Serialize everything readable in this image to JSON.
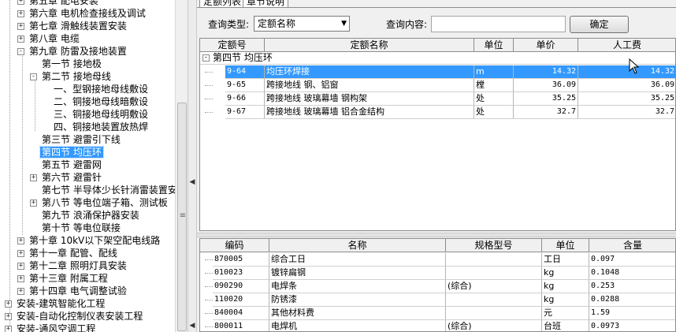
{
  "tree": {
    "items": [
      {
        "label": "第五章 配电安装",
        "level": 1,
        "exp": "+"
      },
      {
        "label": "第六章 电机检查接线及调试",
        "level": 1,
        "exp": "+"
      },
      {
        "label": "第七章 滑触线装置安装",
        "level": 1,
        "exp": "+"
      },
      {
        "label": "第八章 电缆",
        "level": 1,
        "exp": "+"
      },
      {
        "label": "第九章 防雷及接地装置",
        "level": 1,
        "exp": "-"
      },
      {
        "label": "第一节 接地极",
        "level": 2,
        "exp": ""
      },
      {
        "label": "第二节 接地母线",
        "level": 2,
        "exp": "-"
      },
      {
        "label": "一、型钢接地母线敷设",
        "level": 3,
        "exp": ""
      },
      {
        "label": "二、铜接地母线暗敷设",
        "level": 3,
        "exp": ""
      },
      {
        "label": "三、铜接地母线明敷设",
        "level": 3,
        "exp": ""
      },
      {
        "label": "四、铜接地装置放热焊",
        "level": 3,
        "exp": ""
      },
      {
        "label": "第三节 避雷引下线",
        "level": 2,
        "exp": ""
      },
      {
        "label": "第四节 均压环",
        "level": 2,
        "exp": "",
        "selected": true
      },
      {
        "label": "第五节 避雷网",
        "level": 2,
        "exp": ""
      },
      {
        "label": "第六节 避雷针",
        "level": 2,
        "exp": "+"
      },
      {
        "label": "第七节 半导体少长针消雷装置安",
        "level": 2,
        "exp": ""
      },
      {
        "label": "第八节 等电位端子箱、测试板",
        "level": 2,
        "exp": "+"
      },
      {
        "label": "第九节 浪涌保护器安装",
        "level": 2,
        "exp": ""
      },
      {
        "label": "第十节 等电位联接",
        "level": 2,
        "exp": ""
      },
      {
        "label": "第十章 10kV以下架空配电线路",
        "level": 1,
        "exp": "+"
      },
      {
        "label": "第十一章 配管、配线",
        "level": 1,
        "exp": "+"
      },
      {
        "label": "第十二章 照明灯具安装",
        "level": 1,
        "exp": "+"
      },
      {
        "label": "第十三章 附属工程",
        "level": 1,
        "exp": "+"
      },
      {
        "label": "第十四章 电气调整试验",
        "level": 1,
        "exp": "+"
      },
      {
        "label": "安装-建筑智能化工程",
        "level": 0,
        "exp": "+"
      },
      {
        "label": "安装-自动化控制仪表安装工程",
        "level": 0,
        "exp": "+"
      },
      {
        "label": "安装-通风空调工程",
        "level": 0,
        "exp": "+"
      }
    ]
  },
  "tabs": [
    "定额列表",
    "章节说明"
  ],
  "query": {
    "type_label": "查询类型:",
    "type_value": "定额名称",
    "content_label": "查询内容:",
    "content_value": "",
    "ok_label": "确定"
  },
  "quota_table": {
    "headers": [
      "定额号",
      "定额名称",
      "单位",
      "单价",
      "人工费"
    ],
    "group": "第四节 均压环",
    "rows": [
      {
        "code": "9-64",
        "name": "均压环焊接",
        "unit": "m",
        "price": "14.32",
        "labor": "14.32",
        "selected": true
      },
      {
        "code": "9-65",
        "name": "跨接地线 钢、铝窗",
        "unit": "樘",
        "price": "36.09",
        "labor": "36.09"
      },
      {
        "code": "9-66",
        "name": "跨接地线 玻璃幕墙 钢构架",
        "unit": "处",
        "price": "35.25",
        "labor": "35.25"
      },
      {
        "code": "9-67",
        "name": "跨接地线 玻璃幕墙 铝合金结构",
        "unit": "处",
        "price": "32.7",
        "labor": "32.7"
      }
    ]
  },
  "material_table": {
    "headers": [
      "编码",
      "名称",
      "规格型号",
      "单位",
      "含量"
    ],
    "rows": [
      {
        "code": "870005",
        "name": "综合工日",
        "spec": "",
        "unit": "工日",
        "qty": "0.097"
      },
      {
        "code": "010023",
        "name": "镀锌扁钢",
        "spec": "",
        "unit": "kg",
        "qty": "0.1048"
      },
      {
        "code": "090290",
        "name": "电焊条",
        "spec": "(综合)",
        "unit": "kg",
        "qty": "0.253"
      },
      {
        "code": "110020",
        "name": "防锈漆",
        "spec": "",
        "unit": "kg",
        "qty": "0.0288"
      },
      {
        "code": "840004",
        "name": "其他材料费",
        "spec": "",
        "unit": "元",
        "qty": "1.59"
      },
      {
        "code": "800011",
        "name": "电焊机",
        "spec": "(综合)",
        "unit": "台班",
        "qty": "0.0973"
      }
    ]
  },
  "colors": {
    "selection": "#3399ff",
    "panel": "#f0f0f0",
    "grid_line": "#8c8c8c"
  }
}
